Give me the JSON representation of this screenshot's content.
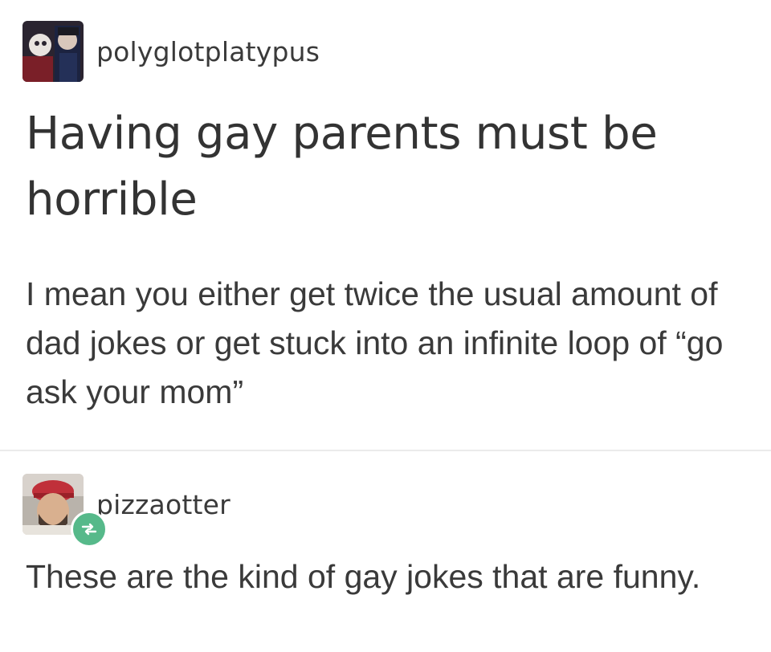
{
  "posts": [
    {
      "username": "polyglotplatypus",
      "title": "Having gay parents must be horrible",
      "body": "I mean you either get twice the usual amount of dad jokes or get stuck into an infinite loop of “go ask your mom”"
    },
    {
      "username": "pizzaotter",
      "body": "These are the kind of gay jokes that are funny.",
      "reblog_badge_color": "#56b98a"
    }
  ]
}
